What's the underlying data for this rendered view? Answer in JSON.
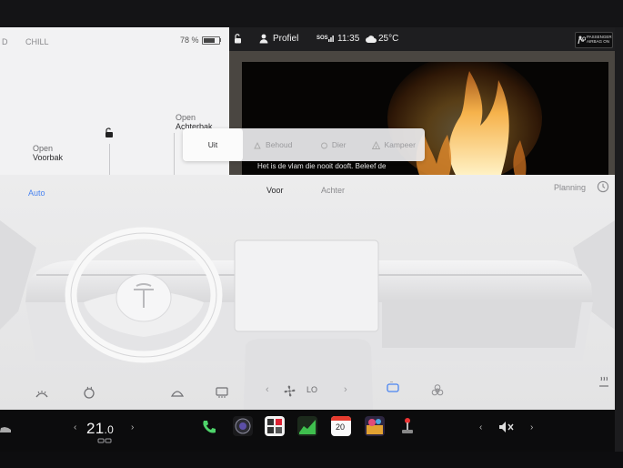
{
  "status": {
    "gear": "D",
    "drive_mode": "CHILL",
    "battery_percent": "78 %",
    "battery_level": 0.78,
    "profile": "Profiel",
    "sos": "SOS",
    "time": "11:35",
    "outside_temp": "25°C",
    "airbag_line1": "PASSENGER",
    "airbag_line2": "AIRBAG ON"
  },
  "vehicle": {
    "frunk_action": "Open",
    "frunk_name": "Voorbak",
    "trunk_action": "Open",
    "trunk_name": "Achterbak"
  },
  "media": {
    "caption": "Het is de vlam die nooit dooft. Beleef de"
  },
  "camp_mode": {
    "options": [
      "Uit",
      "Behoud",
      "Dier",
      "Kampeer"
    ],
    "selected": "Uit"
  },
  "climate": {
    "auto_label": "Auto",
    "tab_front": "Voor",
    "tab_rear": "Achter",
    "schedule_label": "Planning",
    "fan_speed": "LO",
    "accent_color": "#4a84f0"
  },
  "taskbar": {
    "cabin_temp_int": "21",
    "cabin_temp_dec": ".0",
    "calendar_day": "20",
    "icons": [
      "car-icon",
      "phone-icon",
      "camera-icon",
      "media-player-icon",
      "energy-icon",
      "calendar-icon",
      "toybox-icon",
      "joystick-icon",
      "volume-mute-icon"
    ]
  }
}
